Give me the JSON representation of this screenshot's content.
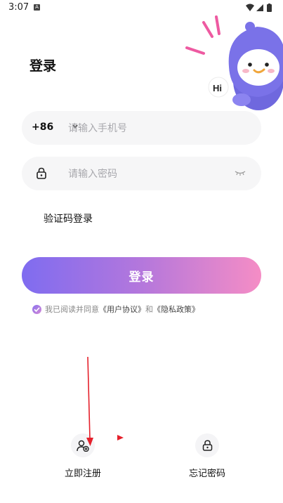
{
  "status_bar": {
    "time": "3:07",
    "notification_icon": "A"
  },
  "mascot": {
    "greeting": "Hi"
  },
  "page": {
    "title": "登录"
  },
  "phone": {
    "country_code": "+86",
    "placeholder": "请输入手机号"
  },
  "password": {
    "placeholder": "请输入密码"
  },
  "sms_login_label": "验证码登录",
  "login_button_label": "登录",
  "agreement": {
    "prefix": "我已阅读并同意",
    "user_agreement": "《用户协议》",
    "and": "和",
    "privacy_policy": "《隐私政策》",
    "checked": true
  },
  "actions": {
    "register_label": "立即注册",
    "forgot_label": "忘记密码"
  },
  "colors": {
    "gradient_start": "#7f6cf0",
    "gradient_end": "#f58dc5",
    "field_bg": "#f6f6f7",
    "annotation": "#e5202b"
  }
}
